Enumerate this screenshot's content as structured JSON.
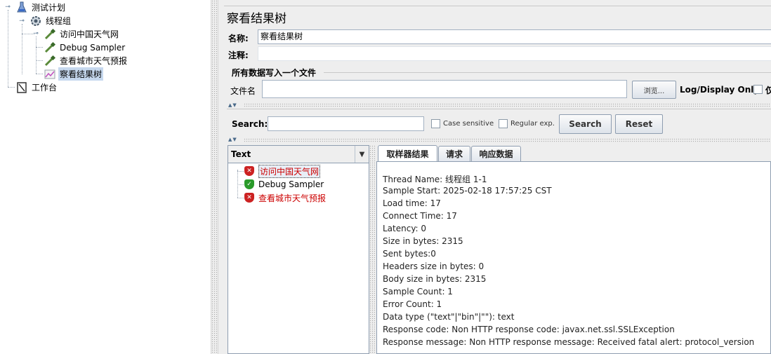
{
  "tree": {
    "nodes": [
      {
        "label": "测试计划",
        "icon": "test-plan-icon"
      },
      {
        "label": "线程组",
        "icon": "thread-group-gear-icon"
      },
      {
        "label": "访问中国天气网",
        "icon": "http-sampler-pipette-icon"
      },
      {
        "label": "Debug Sampler",
        "icon": "debug-sampler-pipette-icon"
      },
      {
        "label": "查看城市天气预报",
        "icon": "http-sampler-pipette-icon"
      },
      {
        "label": "察看结果树",
        "icon": "results-tree-chart-icon"
      },
      {
        "label": "工作台",
        "icon": "workbench-icon"
      }
    ]
  },
  "panel": {
    "title": "察看结果树",
    "name_label": "名称:",
    "name_value": "察看结果树",
    "comment_label": "注释:",
    "comment_value": "",
    "file_group_title": "所有数据写入一个文件",
    "file_label": "文件名",
    "file_value": "",
    "browse_label": "浏览...",
    "log_display_label": "Log/Display Only:",
    "errors_label_partial": "仅"
  },
  "search": {
    "label": "Search:",
    "value": "",
    "case_sensitive_label": "Case sensitive",
    "regex_label": "Regular exp.",
    "search_button": "Search",
    "reset_button": "Reset"
  },
  "results": {
    "renderer": "Text",
    "items": [
      {
        "label": "访问中国天气网",
        "status": "error",
        "selected": true
      },
      {
        "label": "Debug Sampler",
        "status": "ok",
        "selected": false
      },
      {
        "label": "查看城市天气预报",
        "status": "error",
        "selected": false
      }
    ]
  },
  "tabs": [
    {
      "label": "取样器结果",
      "active": true
    },
    {
      "label": "请求",
      "active": false
    },
    {
      "label": "响应数据",
      "active": false
    }
  ],
  "detail_lines": [
    "Thread Name: 线程组 1-1",
    "Sample Start: 2025-02-18 17:57:25 CST",
    "Load time: 17",
    "Connect Time: 17",
    "Latency: 0",
    "Size in bytes: 2315",
    "Sent bytes:0",
    "Headers size in bytes: 0",
    "Body size in bytes: 2315",
    "Sample Count: 1",
    "Error Count: 1",
    "Data type (\"text\"|\"bin\"|\"\"): text",
    "Response code: Non HTTP response code: javax.net.ssl.SSLException",
    "Response message: Non HTTP response message: Received fatal alert: protocol_version"
  ],
  "colors": {
    "error_text": "#cc0000",
    "selection": "#c6d8ee",
    "panel_bg": "#eeeeee"
  }
}
